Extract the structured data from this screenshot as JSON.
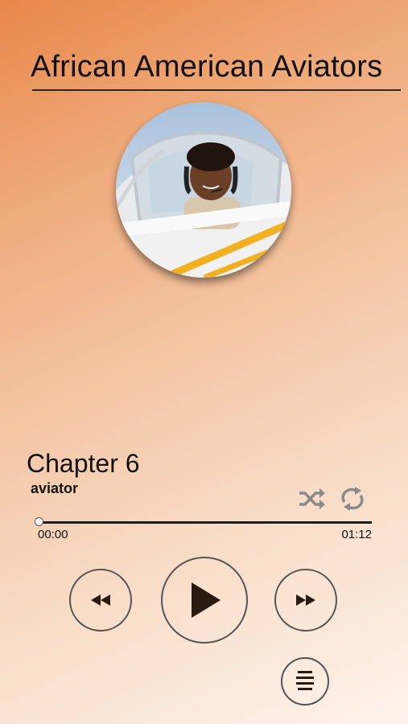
{
  "app": {
    "title": "African American Aviators"
  },
  "artwork": {
    "description_icon": "cover-art-photo"
  },
  "track": {
    "chapter": "Chapter 6",
    "subtitle": "aviator"
  },
  "progress": {
    "current_time": "00:00",
    "duration": "01:12",
    "fraction": 0
  },
  "controls": {
    "shuffle_icon": "shuffle-icon",
    "repeat_icon": "repeat-icon",
    "rewind_icon": "rewind-icon",
    "play_icon": "play-icon",
    "forward_icon": "fast-forward-icon",
    "menu_icon": "menu-icon"
  },
  "colors": {
    "gradient_top": "#e8874a",
    "gradient_bottom": "#fdf3ec",
    "control_icon": "#2b1a10",
    "inactive_icon": "#8a8a8a"
  }
}
